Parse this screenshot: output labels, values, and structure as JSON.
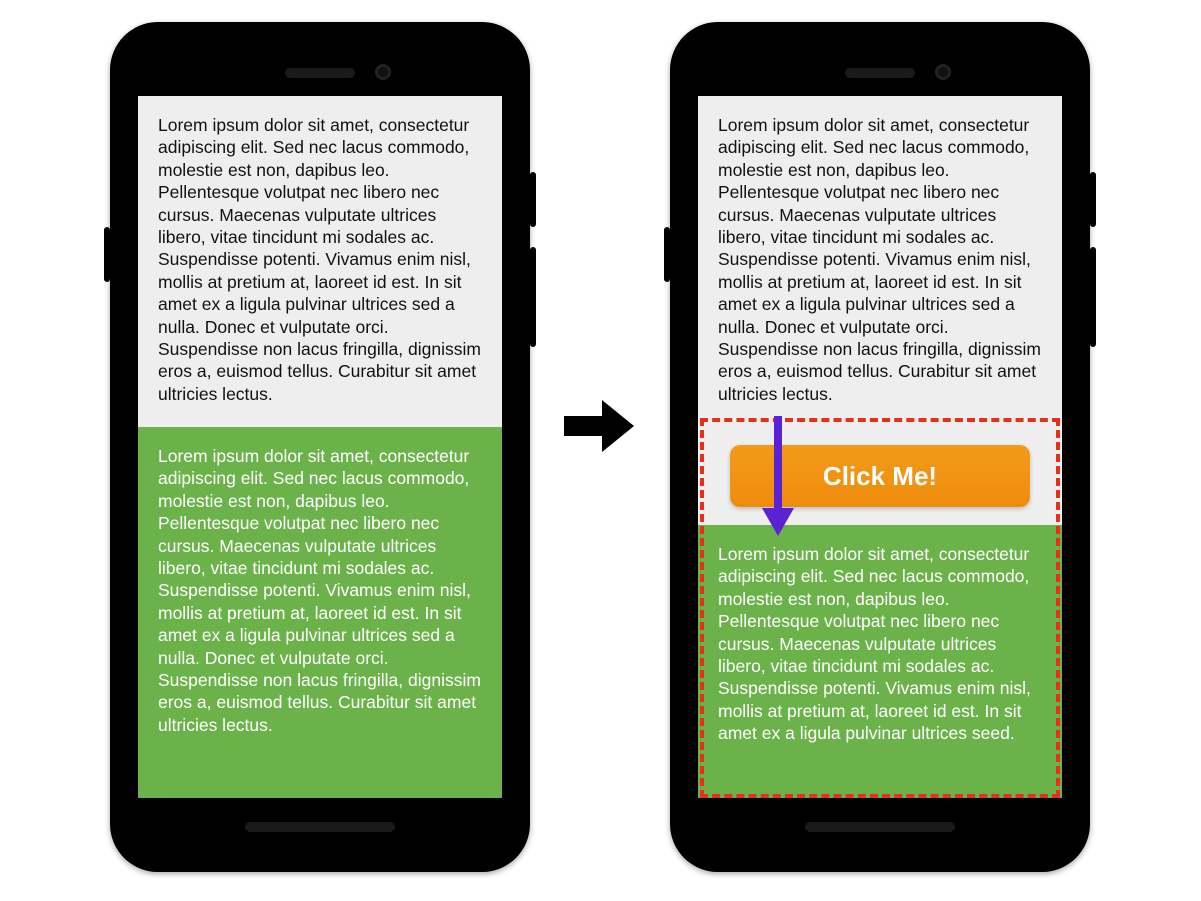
{
  "lorem_full": "Lorem ipsum dolor sit amet, consectetur adipiscing elit. Sed nec lacus commodo, molestie est non, dapibus leo. Pellentesque volutpat nec libero nec cursus. Maecenas vulputate ultrices libero, vitae tincidunt mi sodales ac. Suspendisse potenti. Vivamus enim nisl, mollis at pretium at, laoreet id est. In sit amet ex a ligula pulvinar ultrices sed a nulla. Donec et vulputate orci. Suspendisse non lacus fringilla, dignissim eros a, euismod tellus. Curabitur sit amet ultricies lectus.",
  "lorem_short": "Lorem ipsum dolor sit amet, consectetur adipiscing elit. Sed nec lacus commodo, molestie est non, dapibus leo. Pellentesque volutpat nec libero nec cursus. Maecenas vulputate ultrices libero, vitae tincidunt mi sodales ac. Suspendisse potenti. Vivamus enim nisl, mollis at pretium at, laoreet id est. In sit amet ex a ligula pulvinar ultrices seed.",
  "button_label": "Click Me!",
  "colors": {
    "green": "#6cb24a",
    "orange": "#f3921a",
    "highlight": "#e53119",
    "arrow": "#5b21d4"
  }
}
